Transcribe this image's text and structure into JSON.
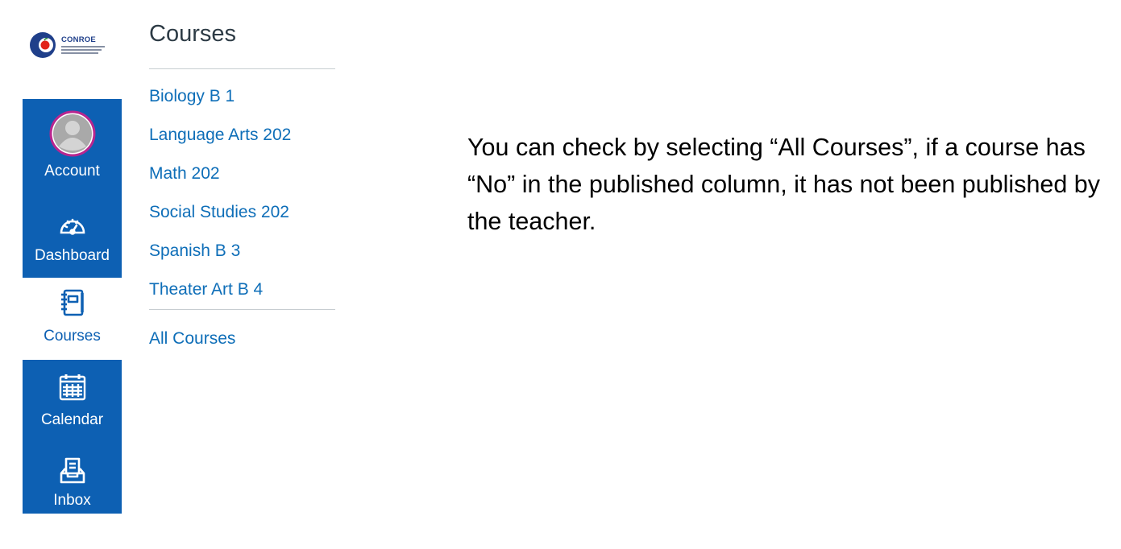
{
  "logo": {
    "wordmark": "CONROE"
  },
  "global_nav": {
    "items": [
      {
        "label": "Account",
        "icon": "avatar-icon",
        "active": false
      },
      {
        "label": "Dashboard",
        "icon": "dashboard-gauge-icon",
        "active": false
      },
      {
        "label": "Courses",
        "icon": "courses-book-icon",
        "active": true
      },
      {
        "label": "Calendar",
        "icon": "calendar-icon",
        "active": false
      },
      {
        "label": "Inbox",
        "icon": "inbox-icon",
        "active": false
      }
    ]
  },
  "tray": {
    "title": "Courses",
    "courses": [
      "Biology B 1",
      "Language Arts 202",
      "Math 202",
      "Social Studies 202",
      "Spanish B 3",
      "Theater Art B 4"
    ],
    "all_courses_label": "All Courses"
  },
  "instruction": {
    "text": "You can check by selecting “All Courses”, if a course has “No” in the published column, it has not been published by the teacher."
  },
  "colors": {
    "nav_blue": "#0d60b3",
    "link_blue": "#0e6eb8",
    "avatar_ring": "#b8268f",
    "logo_red": "#e2231a",
    "logo_navy": "#1f3f8a"
  }
}
